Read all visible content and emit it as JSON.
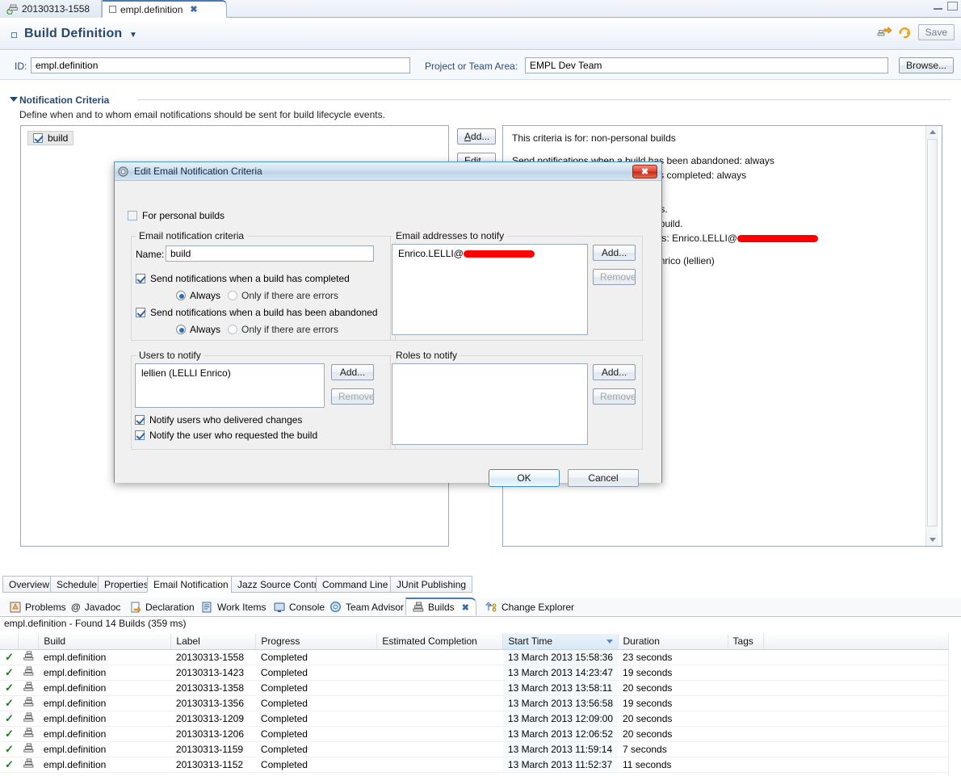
{
  "window": {
    "controls": {
      "minimize": "minimize-icon",
      "maximize": "maximize-icon"
    }
  },
  "editor_tabs": [
    {
      "label": "20130313-1558",
      "icon": "build-result-icon",
      "active": false,
      "closable": false
    },
    {
      "label": "empl.definition",
      "icon": "build-definition-icon",
      "active": true,
      "closable": true,
      "close_glyph": "✖"
    }
  ],
  "header": {
    "title": "Build Definition",
    "dropdown_glyph": "▼",
    "toolbar": {
      "export_icon": "export-build-icon",
      "refresh_icon": "refresh-icon",
      "save_label": "Save"
    }
  },
  "id_row": {
    "id_label": "ID:",
    "id_value": "empl.definition",
    "project_label": "Project or Team Area:",
    "project_value": "EMPL Dev Team",
    "browse_label": "Browse..."
  },
  "section": {
    "title": "Notification Criteria",
    "description": "Define when and to whom email notifications should be sent for build lifecycle events.",
    "criteria_list": [
      {
        "label": "build",
        "checked": true
      }
    ],
    "buttons": {
      "add": "Add...",
      "edit": "Edit..."
    },
    "detail_lines": [
      "This criteria is for: non-personal builds",
      "Send notifications when a build has been abandoned: always",
      "Send notifications when a build has completed: always",
      "Notify users who delivered changes.",
      "Notify the user who requested the build.",
      "Notify the following email addresses: Enrico.LELLI@",
      "Notify the following users: LELLI Enrico (lellien)"
    ]
  },
  "dialog": {
    "title": "Edit Email Notification Criteria",
    "title_icon": "gear-icon",
    "close_glyph": "✖",
    "personal_builds": {
      "label": "For personal builds",
      "checked": false
    },
    "criteria_group": {
      "legend": "Email notification criteria",
      "name_label": "Name:",
      "name_value": "build",
      "completed": {
        "label": "Send notifications when a build has completed",
        "checked": true,
        "options": [
          {
            "label": "Always",
            "selected": true
          },
          {
            "label": "Only if there are errors",
            "selected": false
          }
        ]
      },
      "abandoned": {
        "label": "Send notifications when a build has been abandoned",
        "checked": true,
        "options": [
          {
            "label": "Always",
            "selected": true
          },
          {
            "label": "Only if there are errors",
            "selected": false
          }
        ]
      }
    },
    "emails_group": {
      "legend": "Email addresses to notify",
      "items": [
        "Enrico.LELLI@"
      ],
      "add_label": "Add...",
      "remove_label": "Remove",
      "remove_disabled": true
    },
    "users_group": {
      "legend": "Users to notify",
      "items": [
        "lellien (LELLI Enrico)"
      ],
      "add_label": "Add...",
      "remove_label": "Remove",
      "remove_disabled": true,
      "notify_delivered": {
        "label": "Notify users who delivered changes",
        "checked": true
      },
      "notify_requested": {
        "label": "Notify the user who requested the build",
        "checked": true
      }
    },
    "roles_group": {
      "legend": "Roles to notify",
      "items": [],
      "add_label": "Add...",
      "remove_label": "Remove",
      "remove_disabled": true
    },
    "ok_label": "OK",
    "cancel_label": "Cancel"
  },
  "page_tabs": [
    {
      "label": "Overview",
      "selected": false
    },
    {
      "label": "Schedule",
      "selected": false
    },
    {
      "label": "Properties",
      "selected": false
    },
    {
      "label": "Email Notification",
      "selected": true
    },
    {
      "label": "Jazz Source Control",
      "selected": false
    },
    {
      "label": "Command Line",
      "selected": false
    },
    {
      "label": "JUnit Publishing",
      "selected": false
    }
  ],
  "view_tabs": [
    {
      "label": "Problems",
      "icon": "problems-icon",
      "selected": false
    },
    {
      "label": "Javadoc",
      "icon": "javadoc-at-icon",
      "selected": false
    },
    {
      "label": "Declaration",
      "icon": "declaration-icon",
      "selected": false
    },
    {
      "label": "Work Items",
      "icon": "work-items-icon",
      "selected": false
    },
    {
      "label": "Console",
      "icon": "console-icon",
      "selected": false
    },
    {
      "label": "Team Advisor",
      "icon": "team-advisor-icon",
      "selected": false
    },
    {
      "label": "Builds",
      "icon": "builds-icon",
      "selected": true,
      "close_glyph": "✖"
    },
    {
      "label": "Change Explorer",
      "icon": "change-explorer-icon",
      "selected": false
    }
  ],
  "builds_view": {
    "status": "empl.definition - Found 14 Builds (359 ms)",
    "columns": [
      "",
      "",
      "Build",
      "Label",
      "Progress",
      "Estimated Completion",
      "Start Time",
      "Duration",
      "Tags"
    ],
    "sorted_column": "Start Time",
    "rows": [
      {
        "state_icon": "check-icon",
        "type_icon": "build-icon",
        "build": "empl.definition",
        "label": "20130313-1558",
        "progress": "Completed",
        "estimated": "",
        "start": "13 March 2013 15:58:36",
        "duration": "23 seconds",
        "tags": ""
      },
      {
        "state_icon": "check-icon",
        "type_icon": "build-icon",
        "build": "empl.definition",
        "label": "20130313-1423",
        "progress": "Completed",
        "estimated": "",
        "start": "13 March 2013 14:23:47",
        "duration": "19 seconds",
        "tags": ""
      },
      {
        "state_icon": "check-icon",
        "type_icon": "build-icon",
        "build": "empl.definition",
        "label": "20130313-1358",
        "progress": "Completed",
        "estimated": "",
        "start": "13 March 2013 13:58:11",
        "duration": "20 seconds",
        "tags": ""
      },
      {
        "state_icon": "check-icon",
        "type_icon": "build-icon",
        "build": "empl.definition",
        "label": "20130313-1356",
        "progress": "Completed",
        "estimated": "",
        "start": "13 March 2013 13:56:58",
        "duration": "19 seconds",
        "tags": ""
      },
      {
        "state_icon": "check-icon",
        "type_icon": "build-icon",
        "build": "empl.definition",
        "label": "20130313-1209",
        "progress": "Completed",
        "estimated": "",
        "start": "13 March 2013 12:09:00",
        "duration": "20 seconds",
        "tags": ""
      },
      {
        "state_icon": "check-icon",
        "type_icon": "build-icon",
        "build": "empl.definition",
        "label": "20130313-1206",
        "progress": "Completed",
        "estimated": "",
        "start": "13 March 2013 12:06:52",
        "duration": "20 seconds",
        "tags": ""
      },
      {
        "state_icon": "check-icon",
        "type_icon": "build-icon",
        "build": "empl.definition",
        "label": "20130313-1159",
        "progress": "Completed",
        "estimated": "",
        "start": "13 March 2013 11:59:14",
        "duration": "7 seconds",
        "tags": ""
      },
      {
        "state_icon": "check-icon",
        "type_icon": "build-icon",
        "build": "empl.definition",
        "label": "20130313-1152",
        "progress": "Completed",
        "estimated": "",
        "start": "13 March 2013 11:52:37",
        "duration": "11 seconds",
        "tags": ""
      }
    ]
  },
  "colors": {
    "accent": "#27486e",
    "tab_active_top": "#4a78b0",
    "redaction": "#fe0000",
    "success": "#1f7a1f",
    "dialog_border": "#4a97c4"
  }
}
